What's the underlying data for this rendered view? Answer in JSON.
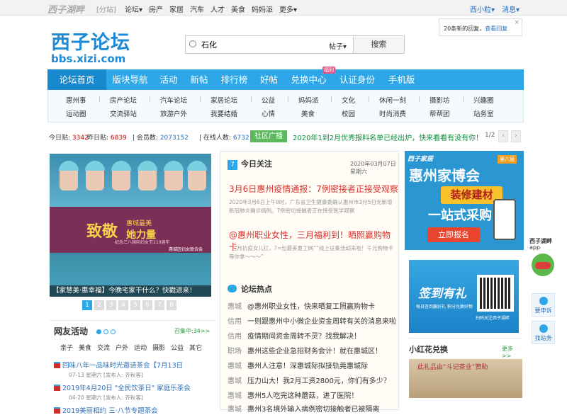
{
  "topbar": {
    "logo": "西子湖畔",
    "sub": "[分站]",
    "nav": [
      "论坛▾",
      "房产",
      "家居",
      "汽车",
      "人才",
      "美食",
      "妈妈派",
      "更多▾"
    ],
    "user": "西小粒▾",
    "message": "消息▾"
  },
  "notice": {
    "text": "20条新的回复，",
    "link": "查看回复",
    "close": "×"
  },
  "brand": {
    "cn": "西子论坛",
    "en": "bbs.xizi.com"
  },
  "search": {
    "value": "石化",
    "type": "帖子▾",
    "button": "搜索"
  },
  "mainnav": [
    {
      "label": "论坛首页",
      "active": true
    },
    {
      "label": "版块导航"
    },
    {
      "label": "活动"
    },
    {
      "label": "新帖"
    },
    {
      "label": "排行榜"
    },
    {
      "label": "好帖"
    },
    {
      "label": "兑换中心"
    },
    {
      "label": "认证身份"
    },
    {
      "label": "手机版"
    }
  ],
  "mainnav_badge": "福利",
  "subnav": {
    "row1": [
      "惠州事",
      "房产论坛",
      "汽车论坛",
      "家居论坛",
      "公益",
      "妈妈派",
      "文化",
      "休闲一刻",
      "摄影坊",
      "兴趣圈"
    ],
    "row2": [
      "运动圈",
      "交流驿站",
      "旅游户外",
      "我要结婚",
      "心情",
      "美食",
      "校园",
      "时尚消费",
      "帮帮团",
      "站务室"
    ]
  },
  "stats": {
    "today_label": "今日贴:",
    "today": "3342",
    "yesterday_label": "昨日贴:",
    "yesterday": "6839",
    "members_label": "会员数:",
    "members": "2073152",
    "online_label": "在线人数:",
    "online": "6732",
    "broadcast": "社区广播",
    "notice": "2020年1到2月优秀报料名单已经出炉，快来看看有没有你！",
    "page": "1/2",
    "prev": "‹",
    "next": "›"
  },
  "slider": {
    "big": "致敬",
    "big_side1": "惠城最美",
    "big_side2": "她力量",
    "small": "纪念三八国际妇女节110周年",
    "org": "惠城区妇女联合会",
    "caption": "【家慧美·惠幸福】今晚宅家干什么？快戳进来！",
    "pages": [
      "1",
      "2",
      "3",
      "4",
      "5",
      "6",
      "7",
      "8"
    ]
  },
  "netact": {
    "title": "网友活动",
    "more": "召集中:34>>",
    "cats": [
      "亲子",
      "美食",
      "交流",
      "户外",
      "运动",
      "摄影",
      "公益",
      "其它"
    ],
    "events": [
      {
        "title": "回味八年一品味时光邀请茶会【7月13日",
        "meta": "07-13 星期六 [发布人: 齐秋客]"
      },
      {
        "title": "2019年4月20日 \"全民饮茶日\" 家庭乐茶会",
        "meta": "04-20 星期六 [发布人: 齐秋客]"
      },
      {
        "title": "2019美丽相约 三·八节专题茶会",
        "meta": ""
      }
    ]
  },
  "today": {
    "num": "7",
    "title": "今日关注",
    "date": "2020年03月07日 星期六",
    "headline1": "3月6日惠州疫情通报：7例密接者正接受观察",
    "para1": "2020年3月6日上午9时，广东省卫生健康委确认惠州市3月5日无新增新冠肺炎确诊病例。7例密切接触者正在接受医学观察",
    "headline2": "@惠州职业女性，三月福利到！晒照赢购物卡",
    "para2": "“三月抗疫女儿红，?=出最美夏工网”“线上征集活动来啦！千元购物卡等你拿～～～”"
  },
  "hot": {
    "title": "论坛热点",
    "rows": [
      {
        "tag": "惠城",
        "text": "@惠州职业女性，快来晒复工照赢购物卡"
      },
      {
        "tag": "信用",
        "text": "一则跟惠州中小微企业资金周转有关的消息来啦"
      },
      {
        "tag": "信用",
        "text": "疫情期间资金周转不灵？找我解决！"
      },
      {
        "tag": "职场",
        "text": "惠州这些企业急招财务会计！就在惠城区！"
      },
      {
        "tag": "惠城",
        "text": "惠州人注意！深惠城际拟接轨莞惠城际"
      },
      {
        "tag": "惠城",
        "text": "压力山大！我2月工资2800元，你们有多少？"
      },
      {
        "tag": "惠城",
        "text": "惠州5人吃完这种蘑菇，进了医院！"
      },
      {
        "tag": "惠城",
        "text": "惠州3名境外输入病例密切接触者已被隔离"
      }
    ]
  },
  "ad1": {
    "brand": "西子家居",
    "title": "惠州家博会",
    "tag": "第八届",
    "btn": "装修建材",
    "line": "一站式采购",
    "cta": "立即报名"
  },
  "ad2": {
    "title": "签到有礼",
    "sub": "每日签到赢好礼 积分兑换好物",
    "qr_caption": "扫码关注西子湖畔"
  },
  "xhh": {
    "title": "小红花兑换",
    "more": "更多>>",
    "img_text": "此礼品由“斗记茶业”赞助"
  },
  "side": {
    "app1": "西子湖畔",
    "app2": "app",
    "b1": "要申诉",
    "b2": "找站务"
  }
}
